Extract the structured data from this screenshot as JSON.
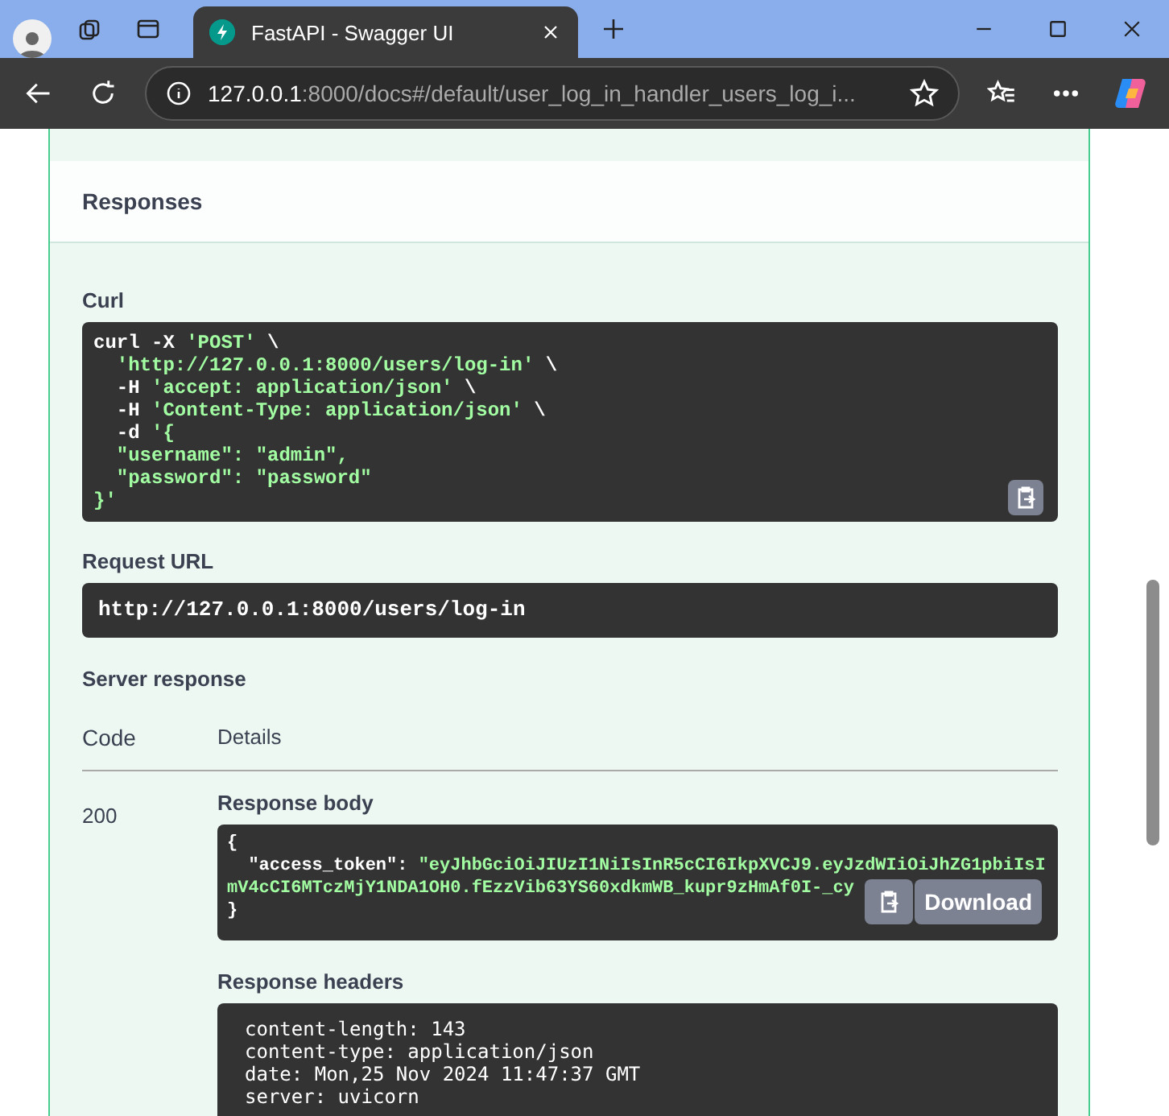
{
  "browser": {
    "tab": {
      "title": "FastAPI - Swagger UI",
      "selected": true
    },
    "address": {
      "host": "127.0.0.1",
      "path": ":8000/docs#/default/user_log_in_handler_users_log_i..."
    }
  },
  "responses": {
    "title": "Responses",
    "curl": {
      "label": "Curl",
      "lines": [
        [
          {
            "kind": "plain",
            "text": "curl -X "
          },
          {
            "kind": "string",
            "text": "'POST'"
          },
          {
            "kind": "plain",
            "text": " \\"
          }
        ],
        [
          {
            "kind": "string",
            "text": "  'http://127.0.0.1:8000/users/log-in'"
          },
          {
            "kind": "plain",
            "text": " \\"
          }
        ],
        [
          {
            "kind": "plain",
            "text": "  -H "
          },
          {
            "kind": "string",
            "text": "'accept: application/json'"
          },
          {
            "kind": "plain",
            "text": " \\"
          }
        ],
        [
          {
            "kind": "plain",
            "text": "  -H "
          },
          {
            "kind": "string",
            "text": "'Content-Type: application/json'"
          },
          {
            "kind": "plain",
            "text": " \\"
          }
        ],
        [
          {
            "kind": "plain",
            "text": "  -d "
          },
          {
            "kind": "string",
            "text": "'{"
          }
        ],
        [
          {
            "kind": "string",
            "text": "  \"username\": \"admin\","
          }
        ],
        [
          {
            "kind": "string",
            "text": "  \"password\": \"password\""
          }
        ],
        [
          {
            "kind": "string",
            "text": "}'"
          }
        ]
      ]
    },
    "request_url": {
      "label": "Request URL",
      "value": "http://127.0.0.1:8000/users/log-in"
    },
    "server_response": {
      "label": "Server response",
      "columns": [
        "Code",
        "Details"
      ],
      "rows": [
        {
          "code": "200",
          "body_label": "Response body",
          "body_lines": [
            [
              {
                "kind": "plain",
                "text": "{"
              }
            ],
            [
              {
                "kind": "plain",
                "text": "  \"access_token\": "
              },
              {
                "kind": "string",
                "text": "\"eyJhbGciOiJIUzI1NiIsInR5cCI6IkpXVCJ9.eyJzdWIiOiJhZG1pbiIsI"
              }
            ],
            [
              {
                "kind": "string",
                "text": "mV4cCI6MTczMjY1NDA1OH0.fEzzVib63YS60xdkmWB_kupr9zHmAf0I-_cy"
              }
            ],
            [
              {
                "kind": "plain",
                "text": "}"
              }
            ]
          ],
          "download": "Download",
          "headers_label": "Response headers",
          "header_lines": [
            "content-length: 143",
            "content-type: application/json",
            "date: Mon,25 Nov 2024 11:47:37 GMT",
            "server: uvicorn"
          ]
        }
      ]
    }
  }
}
